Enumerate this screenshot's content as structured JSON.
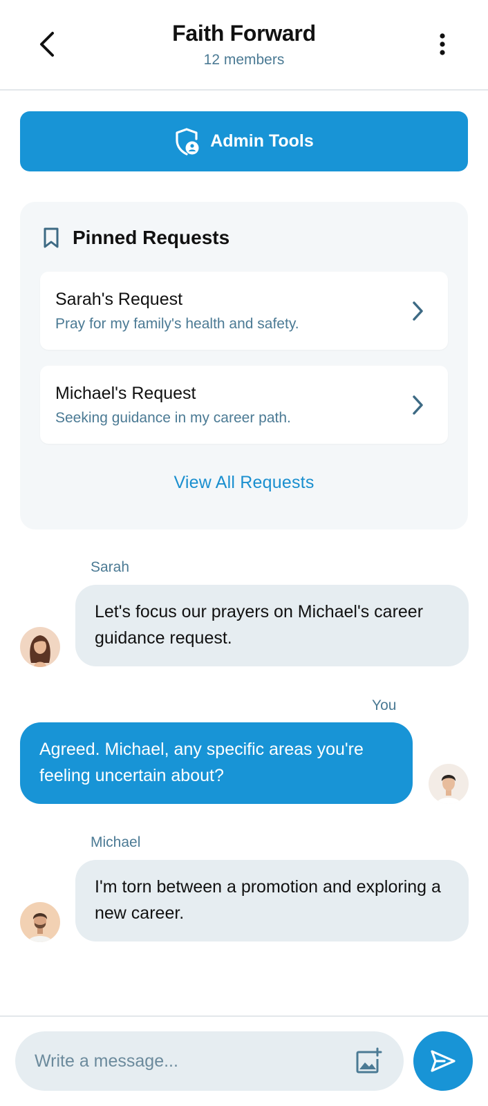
{
  "header": {
    "title": "Faith Forward",
    "subtitle": "12 members"
  },
  "admin": {
    "label": "Admin Tools"
  },
  "pinned": {
    "title": "Pinned Requests",
    "requests": [
      {
        "name": "Sarah's Request",
        "text": "Pray for my family's health and safety."
      },
      {
        "name": "Michael's Request",
        "text": "Seeking guidance in my career path."
      }
    ],
    "view_all": "View All Requests"
  },
  "messages": [
    {
      "sender": "Sarah",
      "text": "Let's focus our prayers on Michael's career guidance request.",
      "direction": "incoming"
    },
    {
      "sender": "You",
      "text": "Agreed. Michael, any specific areas you're feeling uncertain about?",
      "direction": "outgoing"
    },
    {
      "sender": "Michael",
      "text": "I'm torn between a promotion and exploring a new career.",
      "direction": "incoming"
    }
  ],
  "composer": {
    "placeholder": "Write a message..."
  },
  "colors": {
    "accent": "#1894d6",
    "muted_text": "#4b7a94",
    "bubble_incoming": "#e6edf1",
    "panel_bg": "#f4f7f9"
  },
  "icons": {
    "back": "chevron-left-icon",
    "menu": "more-vertical-icon",
    "admin": "shield-user-icon",
    "pinned": "bookmark-icon",
    "chevron": "chevron-right-icon",
    "image": "add-image-icon",
    "send": "send-icon"
  }
}
